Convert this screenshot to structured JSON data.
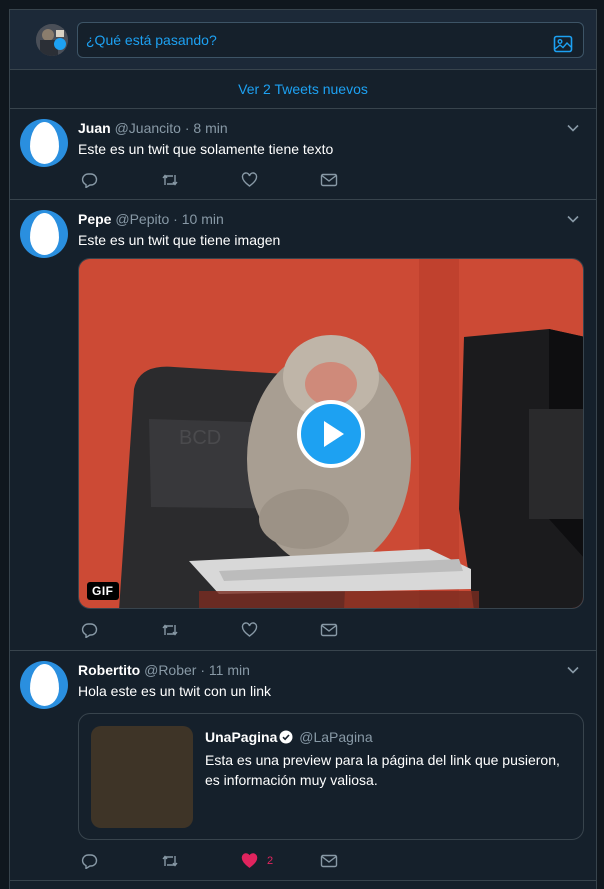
{
  "compose": {
    "placeholder": "¿Qué está pasando?"
  },
  "new_tweets_label": "Ver 2 Tweets nuevos",
  "tweets": [
    {
      "name": "Juan",
      "handle": "@Juancito",
      "separator": "·",
      "time": "8 min",
      "text": "Este es un twit que solamente tiene texto"
    },
    {
      "name": "Pepe",
      "handle": "@Pepito",
      "separator": "·",
      "time": "10 min",
      "text": "Este es un twit que tiene imagen",
      "media": {
        "badge": "GIF",
        "type": "gif"
      }
    },
    {
      "name": "Robertito",
      "handle": "@Rober",
      "separator": "·",
      "time": "11 min",
      "text": "Hola este es un twit con un link",
      "like_count": "2",
      "liked": true,
      "link_card": {
        "name": "UnaPagina",
        "handle": "@LaPagina",
        "verified": true,
        "description": "Esta es una preview para la página del link que pusieron, es información muy valiosa."
      }
    }
  ],
  "colors": {
    "accent": "#1da1f2",
    "like": "#e0245e",
    "muted": "#8899a6",
    "background": "#15202b"
  },
  "icons": [
    "image-icon",
    "chevron-down-icon",
    "reply-icon",
    "retweet-icon",
    "heart-icon",
    "message-icon",
    "play-icon",
    "verified-icon"
  ]
}
